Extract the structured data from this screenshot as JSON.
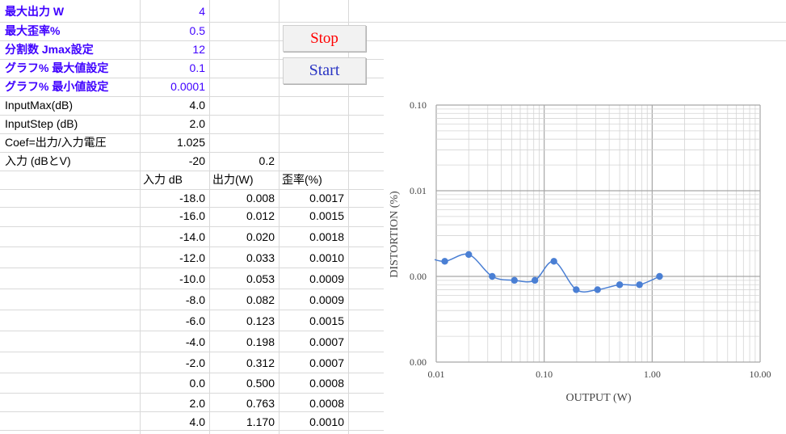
{
  "params": [
    {
      "label": "最大出力 W",
      "value": "4",
      "purple": true
    },
    {
      "label": "最大歪率%",
      "value": "0.5",
      "purple": true
    },
    {
      "label": "分割数 Jmax設定",
      "value": "12",
      "purple": true
    },
    {
      "label": "グラフ% 最大値設定",
      "value": "0.1",
      "purple": true
    },
    {
      "label": "グラフ% 最小値設定",
      "value": "0.0001",
      "purple": true
    },
    {
      "label": "InputMax(dB)",
      "value": "4.0",
      "purple": false
    },
    {
      "label": "InputStep (dB)",
      "value": "2.0",
      "purple": false
    },
    {
      "label": "Coef=出力/入力電圧",
      "value": "1.025",
      "purple": false
    }
  ],
  "input_row": {
    "label": "入力 (dBとV)",
    "db": "-20",
    "v": "0.2"
  },
  "table": {
    "headers": [
      "入力 dB",
      "出力(W)",
      "歪率(%)"
    ],
    "rows": [
      [
        "-18.0",
        "0.008",
        "0.0017"
      ],
      [
        "-16.0",
        "0.012",
        "0.0015"
      ],
      [
        "-14.0",
        "0.020",
        "0.0018"
      ],
      [
        "-12.0",
        "0.033",
        "0.0010"
      ],
      [
        "-10.0",
        "0.053",
        "0.0009"
      ],
      [
        "-8.0",
        "0.082",
        "0.0009"
      ],
      [
        "-6.0",
        "0.123",
        "0.0015"
      ],
      [
        "-4.0",
        "0.198",
        "0.0007"
      ],
      [
        "-2.0",
        "0.312",
        "0.0007"
      ],
      [
        "0.0",
        "0.500",
        "0.0008"
      ],
      [
        "2.0",
        "0.763",
        "0.0008"
      ],
      [
        "4.0",
        "1.170",
        "0.0010"
      ]
    ]
  },
  "buttons": {
    "stop": "Stop",
    "start": "Start"
  },
  "chart_data": {
    "type": "scatter",
    "xlabel": "OUTPUT (W)",
    "ylabel": "DISTORTION (%)",
    "x_scale": "log",
    "y_scale": "log",
    "xlim": [
      0.01,
      10
    ],
    "ylim": [
      0.0001,
      0.1
    ],
    "x_ticks": [
      "0.01",
      "0.10",
      "1.00",
      "10.00"
    ],
    "y_ticks": [
      "0.10",
      "0.01",
      "0.00",
      "0.00"
    ],
    "grid": true,
    "smooth_line": true,
    "color": "#4a7fd4",
    "x": [
      0.008,
      0.012,
      0.02,
      0.033,
      0.053,
      0.082,
      0.123,
      0.198,
      0.312,
      0.5,
      0.763,
      1.17
    ],
    "y": [
      0.0017,
      0.0015,
      0.0018,
      0.001,
      0.0009,
      0.0009,
      0.0015,
      0.0007,
      0.0007,
      0.0008,
      0.0008,
      0.001
    ]
  }
}
